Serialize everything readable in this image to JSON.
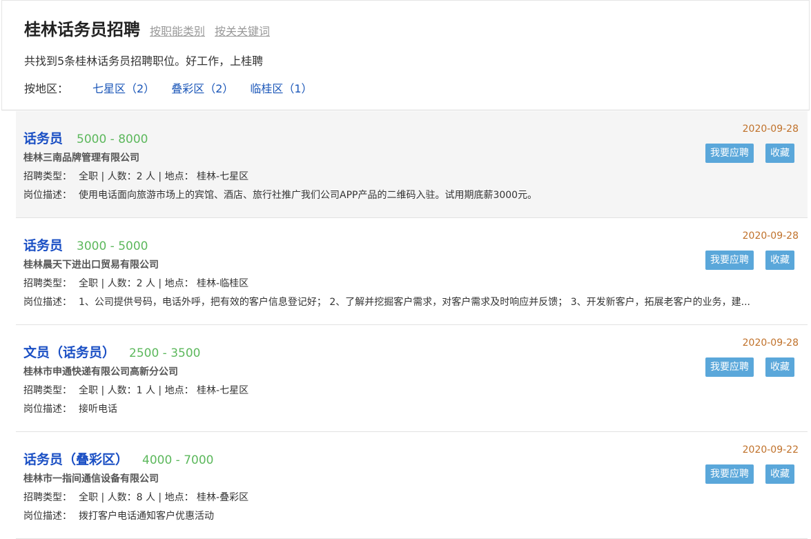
{
  "header": {
    "title": "桂林话务员招聘",
    "filter_by_category": "按职能类别",
    "filter_by_keyword": "按关关键词",
    "summary": "共找到5条桂林话务员招聘职位。好工作，上桂聘",
    "area_label": "按地区：",
    "areas": [
      "七星区（2）",
      "叠彩区（2）",
      "临桂区（1）"
    ]
  },
  "labels": {
    "type": "招聘类型：",
    "desc": "岗位描述：",
    "apply": "我要应聘",
    "favorite": "收藏"
  },
  "jobs": [
    {
      "title": "话务员",
      "salary": "5000 - 8000",
      "company": "桂林三南品牌管理有限公司",
      "meta": "全职 | 人数：2 人 | 地点：  桂林-七星区",
      "description": "使用电话面向旅游市场上的宾馆、酒店、旅行社推广我们公司APP产品的二维码入驻。试用期底薪3000元。",
      "date": "2020-09-28"
    },
    {
      "title": "话务员",
      "salary": "3000 - 5000",
      "company": "桂林晨天下进出口贸易有限公司",
      "meta": "全职 | 人数：2 人 | 地点：  桂林-临桂区",
      "description": "1、公司提供号码，电话外呼，把有效的客户信息登记好；  2、了解并挖掘客户需求，对客户需求及时响应并反馈；  3、开发新客户，拓展老客户的业务，建...",
      "date": "2020-09-28"
    },
    {
      "title": "文员（话务员）",
      "salary": "2500 - 3500",
      "company": "桂林市申通快递有限公司高新分公司",
      "meta": "全职 | 人数：1 人 | 地点：  桂林-七星区",
      "description": "接听电话",
      "date": "2020-09-28"
    },
    {
      "title": "话务员（叠彩区）",
      "salary": "4000 - 7000",
      "company": "桂林市一指间通信设备有限公司",
      "meta": "全职 | 人数：8 人 | 地点：  桂林-叠彩区",
      "description": "拨打客户电话通知客户优惠活动",
      "date": "2020-09-22"
    }
  ]
}
